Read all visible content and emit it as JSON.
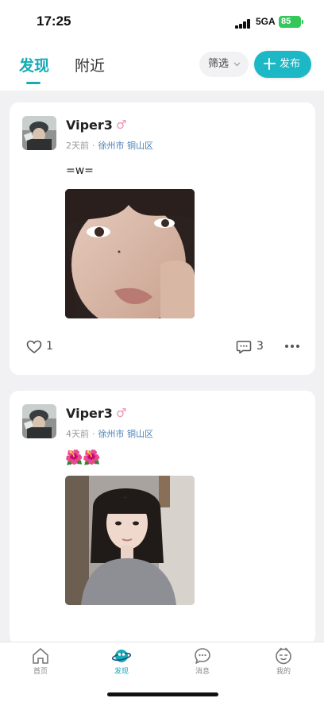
{
  "status_bar": {
    "time": "17:25",
    "network": "5GA",
    "battery": "85"
  },
  "header": {
    "tabs": [
      {
        "label": "发现",
        "active": true
      },
      {
        "label": "附近",
        "active": false
      }
    ],
    "filter_label": "筛选",
    "publish_label": "发布"
  },
  "posts": [
    {
      "username": "Viper3",
      "gender_symbol": "♂",
      "time_ago": "2天前",
      "separator": "·",
      "location": "徐州市 铜山区",
      "text": "=w=",
      "likes": "1",
      "comments": "3"
    },
    {
      "username": "Viper3",
      "gender_symbol": "♂",
      "time_ago": "4天前",
      "separator": "·",
      "location": "徐州市 铜山区",
      "text": "🌺🌺"
    }
  ],
  "tabbar": {
    "items": [
      {
        "label": "首页",
        "icon": "home-icon",
        "active": false
      },
      {
        "label": "发现",
        "icon": "planet-icon",
        "active": true
      },
      {
        "label": "消息",
        "icon": "chat-bubble-icon",
        "active": false
      },
      {
        "label": "我的",
        "icon": "face-icon",
        "active": false
      }
    ]
  },
  "colors": {
    "accent": "#16aab7",
    "publish_button": "#1cb8c6",
    "location_link": "#4a7fb5",
    "gender_male": "#f08fb6",
    "battery": "#34c759",
    "background": "#f1f1f3"
  }
}
